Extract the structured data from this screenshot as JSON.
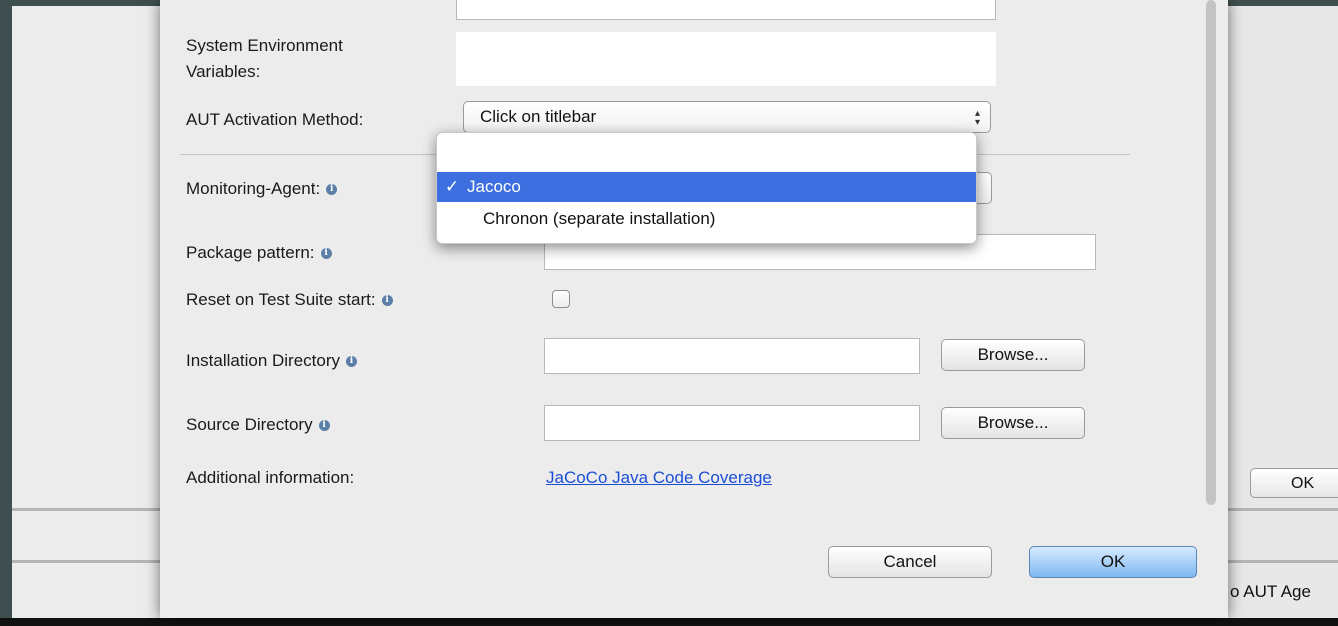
{
  "background_window": {
    "ok_button_label": "OK",
    "status_text": "o AUT Age"
  },
  "dialog": {
    "rows": {
      "system_env_label_line1": "System Environment",
      "system_env_label_line2": "Variables:",
      "aut_activation_label": "AUT Activation Method:",
      "aut_activation_value": "Click on titlebar",
      "monitoring_agent_label": "Monitoring-Agent:",
      "package_pattern_label": "Package pattern:",
      "reset_label": "Reset on Test Suite start:",
      "installation_dir_label": "Installation Directory",
      "source_dir_label": "Source Directory",
      "additional_info_label": "Additional information:",
      "additional_info_link": "JaCoCo Java Code Coverage"
    },
    "browse_label": "Browse...",
    "cancel_label": "Cancel",
    "ok_label": "OK",
    "info_icon_glyph": "i",
    "reset_checked": false
  },
  "monitoring_dropdown": {
    "checkmark": "✓",
    "options": [
      {
        "label": "Jacoco",
        "selected": true
      },
      {
        "label": "Chronon (separate installation)",
        "selected": false
      }
    ]
  },
  "colors": {
    "selection": "#3d6fe0",
    "link": "#1a4fd6",
    "default_button": "#7fb7f0"
  }
}
